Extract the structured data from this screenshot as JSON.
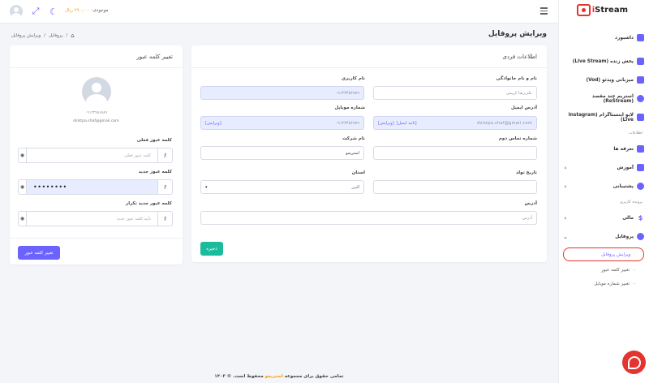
{
  "topbar": {
    "balance_label": "موجودی:",
    "balance_amount": "۲۹۰,۰۰۰ ریال",
    "fullscreen_icon": "expand-icon",
    "theme_icon": "moon-icon"
  },
  "breadcrumb": {
    "items": [
      "پروفایل",
      "ویرایش پروفایل"
    ]
  },
  "page_title": "ویرایش پروفایل",
  "sidebar": {
    "logo_text": "Stream",
    "items": [
      {
        "label": "داشبورد",
        "icon": "home-icon"
      },
      {
        "label": "پخش زنده (Live Stream)",
        "icon": "live-icon"
      },
      {
        "label": "میزبانی ویدئو (Vod)",
        "icon": "video-icon"
      },
      {
        "label": "استریم چند مقصد (ReStream)",
        "icon": "restream-icon"
      },
      {
        "label": "لایو اینستاگرام (Instagram Live)",
        "icon": "instagram-icon"
      }
    ],
    "section_info": "اطلاعات",
    "info_items": [
      {
        "label": "تعرفه ها",
        "icon": "tag-icon"
      },
      {
        "label": "آموزش",
        "icon": "graduation-icon"
      },
      {
        "label": "پشتیبانی",
        "icon": "support-icon"
      }
    ],
    "section_user": "پرونده کاربری",
    "user_items": [
      {
        "label": "مالی",
        "icon": "dollar-icon"
      },
      {
        "label": "پروفایل",
        "icon": "user-icon"
      }
    ],
    "profile_sub": [
      "ویرایش پروفایل",
      "تغییر کلمه عبور",
      "تغییر شماره موبایل"
    ]
  },
  "profile_card": {
    "title": "اطلاعات فردی",
    "fields": {
      "name_label": "نام و نام خانوادگی",
      "name_value": "علی‌رضا کریمی",
      "username_label": "نام کاربری",
      "username_value": "۰۹۱۲۳۴۵۶۷۸۹",
      "email_label": "آدرس ایمیل",
      "email_value": "dslstpa.shaf@gmail.com",
      "email_verify": "تائید ایمیل",
      "email_edit": "ویرایش",
      "mobile_label": "شماره موبایل",
      "mobile_value": "۰۹۱۲۳۴۵۶۷۸۹",
      "mobile_edit": "ویرایش",
      "phone2_label": "شماره تماس دوم",
      "phone2_value": "",
      "company_label": "نام شرکت",
      "company_value": "استریمو",
      "birth_label": "تاریخ تولد",
      "birth_value": "",
      "province_label": "استان",
      "province_value": "البرز",
      "address_label": "آدرس",
      "address_placeholder": "آدرس"
    },
    "save_label": "ذخیره"
  },
  "password_card": {
    "title": "تغییر کلمه عبور",
    "phone": "۰۹۱۲۳۴۵۶۷۸۹",
    "email": "dslstpa.shaf@gmail.com",
    "current_label": "کلمه عبور فعلی",
    "current_placeholder": "کلمه عبور فعلی",
    "new_label": "کلمه عبور جدید",
    "new_value": "••••••••",
    "repeat_label": "کلمه عبور جدید تکرار",
    "repeat_placeholder": "تأیید کلمه عبور جدید",
    "submit_label": "تغییر کلمه عبور"
  },
  "footer": {
    "prefix": "تمامی حقوق برای مجموعه",
    "brand": "استریمو",
    "suffix": "محفوظ است. © ۱۴۰۳"
  },
  "colors": {
    "accent": "#6c63ff",
    "brand_red": "#e3342f",
    "save_green": "#1abc9c",
    "balance_orange": "#f39c12"
  }
}
